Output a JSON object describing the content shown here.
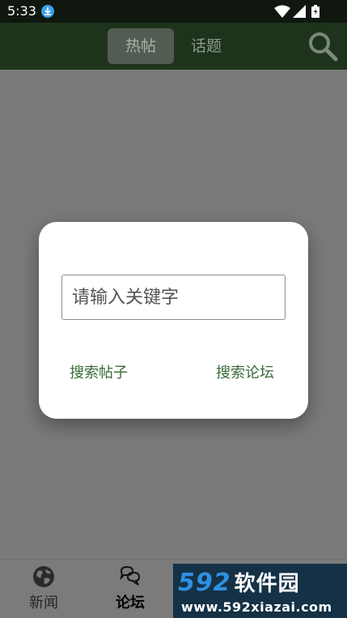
{
  "status_bar": {
    "time": "5:33"
  },
  "top_bar": {
    "tabs": [
      {
        "label": "热帖",
        "active": true
      },
      {
        "label": "话题",
        "active": false
      }
    ]
  },
  "dialog": {
    "input_placeholder": "请输入关键字",
    "input_value": "",
    "search_posts_label": "搜索帖子",
    "search_forum_label": "搜索论坛"
  },
  "bottom_nav": {
    "items": [
      {
        "label": "新闻",
        "icon": "globe-icon"
      },
      {
        "label": "论坛",
        "icon": "chat-bubbles-icon"
      }
    ]
  },
  "watermark": {
    "brand_number": "592",
    "brand_cn": "软件园",
    "url": "www.592xiazai.com"
  },
  "colors": {
    "top_bar": "#1e331c",
    "accent_text": "#3a6b37",
    "overlay": "#7a7a7a"
  }
}
